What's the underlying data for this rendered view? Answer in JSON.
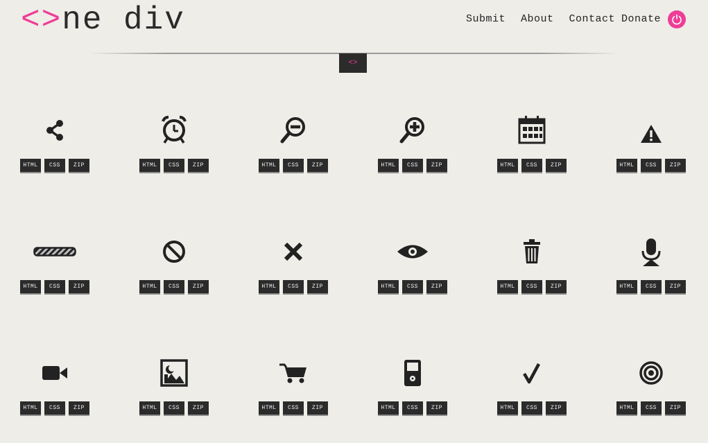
{
  "header": {
    "logo_mark": "<>",
    "logo_text": "ne div"
  },
  "nav": {
    "submit": "Submit",
    "about": "About",
    "contact": "Contact",
    "donate": "Donate"
  },
  "divider_badge": "<>",
  "colors": {
    "accent": "#ee3d96",
    "dark": "#2b2b2b",
    "background": "#eeede8"
  },
  "icons": [
    {
      "name": "share-icon"
    },
    {
      "name": "alarm-clock-icon"
    },
    {
      "name": "zoom-out-icon"
    },
    {
      "name": "zoom-in-icon"
    },
    {
      "name": "calendar-icon"
    },
    {
      "name": "warning-icon"
    },
    {
      "name": "loading-bar-icon"
    },
    {
      "name": "prohibited-icon"
    },
    {
      "name": "close-icon"
    },
    {
      "name": "eye-icon"
    },
    {
      "name": "trash-icon"
    },
    {
      "name": "microphone-icon"
    },
    {
      "name": "video-camera-icon"
    },
    {
      "name": "image-icon"
    },
    {
      "name": "shopping-cart-icon"
    },
    {
      "name": "media-player-icon"
    },
    {
      "name": "checkmark-icon"
    },
    {
      "name": "target-icon"
    }
  ],
  "buttons": {
    "html": "HTML",
    "css": "CSS",
    "zip": "ZIP"
  }
}
